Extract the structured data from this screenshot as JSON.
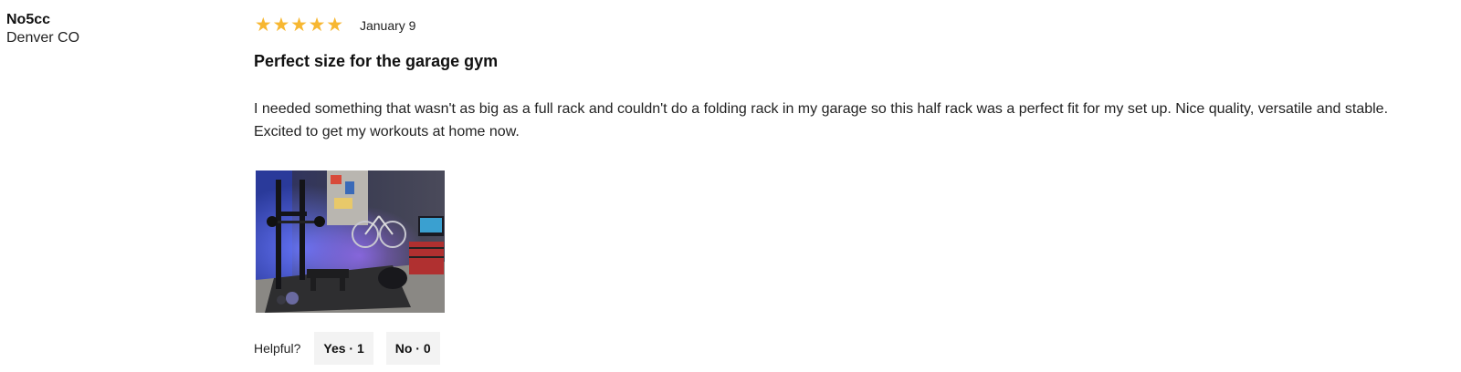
{
  "review": {
    "author": {
      "name": "No5cc",
      "location": "Denver CO"
    },
    "rating": 5,
    "rating_max": 5,
    "stars": [
      "★",
      "★",
      "★",
      "★",
      "★"
    ],
    "date": "January 9",
    "title": "Perfect size for the garage gym",
    "body": "I needed something that wasn't as big as a full rack and couldn't do a folding rack in my garage so this half rack was a perfect fit for my set up. Nice quality, versatile and stable. Excited to get my workouts at home now.",
    "photo_icon": "review-photo-thumbnail",
    "helpful": {
      "label": "Helpful?",
      "yes_label": "Yes · 1",
      "no_label": "No · 0"
    }
  },
  "colors": {
    "star": "#f7b731",
    "button_bg": "#f3f3f3",
    "text": "#222222"
  }
}
